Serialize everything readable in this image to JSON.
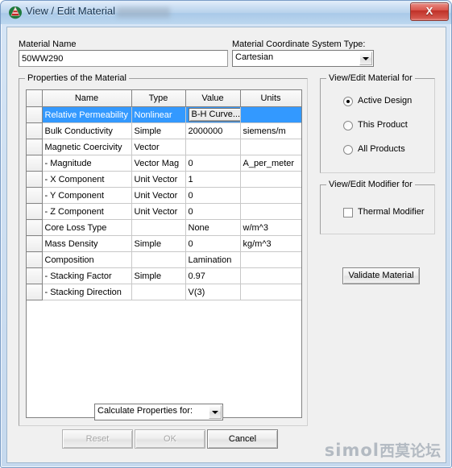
{
  "window": {
    "title": "View / Edit Material",
    "icon": "app-icon",
    "close_label": "X",
    "redacted_present": true
  },
  "form": {
    "material_name_label": "Material Name",
    "material_name_value": "50WW290",
    "coord_system_label": "Material Coordinate System Type:",
    "coord_system_value": "Cartesian"
  },
  "properties_group": {
    "title": "Properties of the Material",
    "columns": [
      "",
      "Name",
      "Type",
      "Value",
      "Units"
    ],
    "rows": [
      {
        "name": "Relative Permeability",
        "type": "Nonlinear",
        "value": "B-H Curve...",
        "units": "",
        "selected": true,
        "value_is_button": true
      },
      {
        "name": "Bulk Conductivity",
        "type": "Simple",
        "value": "2000000",
        "units": "siemens/m",
        "selected": false,
        "value_is_button": false
      },
      {
        "name": "Magnetic Coercivity",
        "type": "Vector",
        "value": "",
        "units": "",
        "selected": false,
        "value_is_button": false
      },
      {
        "name": "-  Magnitude",
        "type": "Vector Mag",
        "value": "0",
        "units": "A_per_meter",
        "selected": false,
        "value_is_button": false
      },
      {
        "name": "- X Component",
        "type": "Unit Vector",
        "value": "1",
        "units": "",
        "selected": false,
        "value_is_button": false
      },
      {
        "name": "- Y Component",
        "type": "Unit Vector",
        "value": "0",
        "units": "",
        "selected": false,
        "value_is_button": false
      },
      {
        "name": "- Z Component",
        "type": "Unit Vector",
        "value": "0",
        "units": "",
        "selected": false,
        "value_is_button": false
      },
      {
        "name": "Core Loss Type",
        "type": "",
        "value": "None",
        "units": "w/m^3",
        "selected": false,
        "value_is_button": false
      },
      {
        "name": "Mass Density",
        "type": "Simple",
        "value": "0",
        "units": "kg/m^3",
        "selected": false,
        "value_is_button": false
      },
      {
        "name": "Composition",
        "type": "",
        "value": "Lamination",
        "units": "",
        "selected": false,
        "value_is_button": false
      },
      {
        "name": "- Stacking Factor",
        "type": "Simple",
        "value": "0.97",
        "units": "",
        "selected": false,
        "value_is_button": false
      },
      {
        "name": "- Stacking Direction",
        "type": "",
        "value": "V(3)",
        "units": "",
        "selected": false,
        "value_is_button": false
      }
    ]
  },
  "view_edit_material_for": {
    "title": "View/Edit Material for",
    "options": [
      {
        "label": "Active Design",
        "checked": true
      },
      {
        "label": "This Product",
        "checked": false
      },
      {
        "label": "All Products",
        "checked": false
      }
    ]
  },
  "view_edit_modifier_for": {
    "title": "View/Edit Modifier for",
    "checkbox_label": "Thermal Modifier",
    "checked": false
  },
  "buttons": {
    "validate_material": "Validate Material",
    "reset": "Reset",
    "ok": "OK",
    "cancel": "Cancel"
  },
  "calculate_combo": {
    "value": "Calculate Properties for:"
  },
  "watermark": {
    "latin": "simol",
    "chinese": "西莫论坛"
  },
  "colors": {
    "selection": "#3399ff",
    "titlebar": "#b7d2ec",
    "close_button": "#bf3027",
    "client_bg": "#f0f0f0"
  }
}
